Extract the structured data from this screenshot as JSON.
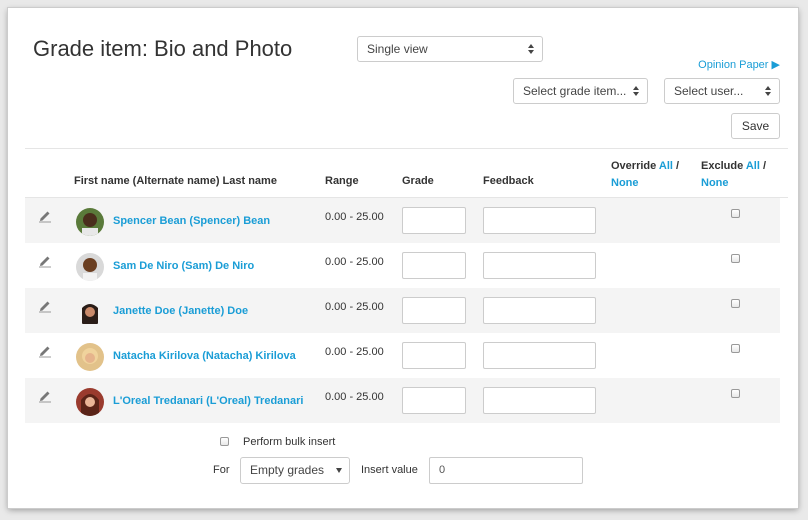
{
  "header": {
    "title": "Grade item: Bio and Photo",
    "view_select": "Single view",
    "opinion_link": "Opinion Paper",
    "grade_item_select": "Select grade item...",
    "user_select": "Select user...",
    "save_label": "Save"
  },
  "table": {
    "col_name": "First name (Alternate name) Last name",
    "col_range": "Range",
    "col_grade": "Grade",
    "col_feedback": "Feedback",
    "col_override": "Override",
    "col_exclude": "Exclude",
    "all_link": "All",
    "slash": "/",
    "none_link": "None",
    "rows": [
      {
        "name": "Spencer Bean (Spencer) Bean",
        "range": "0.00 - 25.00"
      },
      {
        "name": "Sam De Niro (Sam) De Niro",
        "range": "0.00 - 25.00"
      },
      {
        "name": "Janette Doe (Janette) Doe",
        "range": "0.00 - 25.00"
      },
      {
        "name": "Natacha Kirilova (Natacha) Kirilova",
        "range": "0.00 - 25.00"
      },
      {
        "name": "L'Oreal Tredanari (L'Oreal) Tredanari",
        "range": "0.00 - 25.00"
      }
    ]
  },
  "bulk": {
    "label": "Perform bulk insert",
    "for_label": "For",
    "mode_select": "Empty grades",
    "insert_label": "Insert value",
    "insert_value": "0"
  },
  "colors": {
    "link": "#1a9dd6",
    "stripe": "#f4f4f4"
  },
  "icons": [
    "edit-pencil-icon",
    "dropdown-arrows-icon",
    "play-arrow-icon"
  ]
}
